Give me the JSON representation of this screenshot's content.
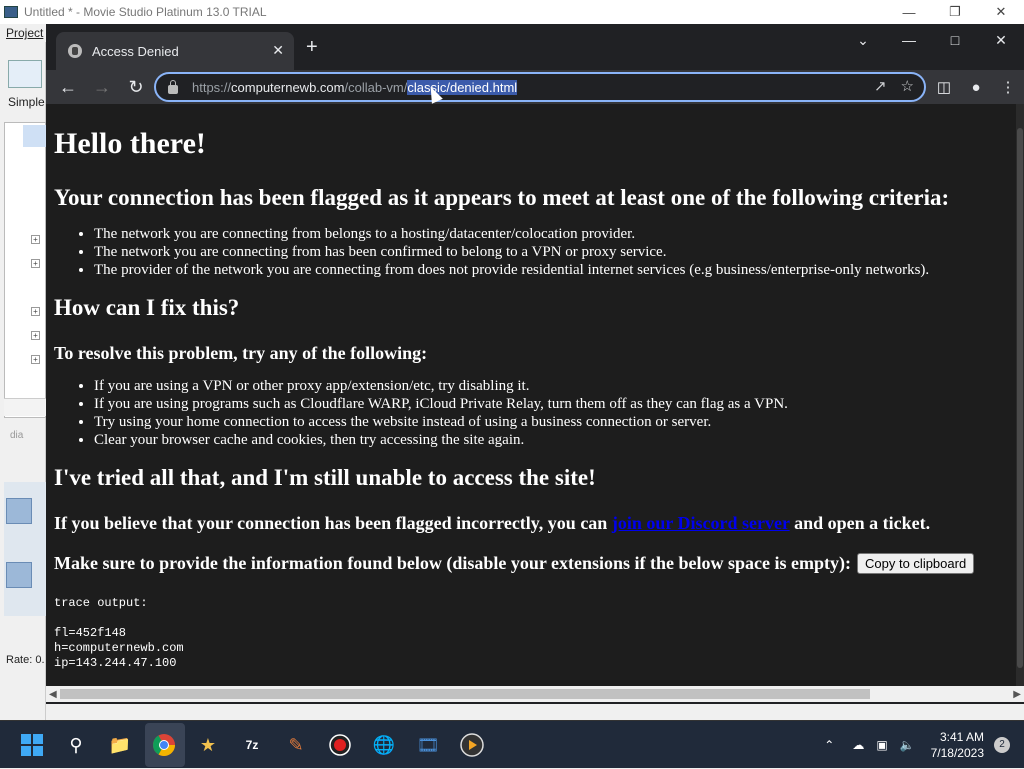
{
  "app": {
    "title": "Untitled * - Movie Studio Platinum 13.0 TRIAL",
    "menu_project": "Project",
    "simple_label": "Simple",
    "dia_label": "dia",
    "rate_label": "Rate: 0."
  },
  "browser": {
    "tab_title": "Access Denied",
    "url_prefix": "https://",
    "url_domain": "computernewb.com",
    "url_path_dim": "/collab-vm/",
    "url_path_selected": "classic/denied.html"
  },
  "page": {
    "hello": "Hello there!",
    "flagged_heading": "Your connection has been flagged as it appears to meet at least one of the following criteria:",
    "criteria": [
      "The network you are connecting from belongs to a hosting/datacenter/colocation provider.",
      "The network you are connecting from has been confirmed to belong to a VPN or proxy service.",
      "The provider of the network you are connecting from does not provide residential internet services (e.g business/enterprise-only networks)."
    ],
    "fix_heading": "How can I fix this?",
    "resolve_heading": "To resolve this problem, try any of the following:",
    "fixes": [
      "If you are using a VPN or other proxy app/extension/etc, try disabling it.",
      "If you are using programs such as Cloudflare WARP, iCloud Private Relay, turn them off as they can flag as a VPN.",
      "Try using your home connection to access the website instead of using a business connection or server.",
      "Clear your browser cache and cookies, then try accessing the site again."
    ],
    "tried_heading": "I've tried all that, and I'm still unable to access the site!",
    "contact_before": "If you believe that your connection has been flagged incorrectly, you can ",
    "contact_link": "join our Discord server",
    "contact_after": " and open a ticket.",
    "provide_text": "Make sure to provide the information found below (disable your extensions if the below space is empty):",
    "copy_button": "Copy to clipboard",
    "trace_lines": [
      "trace output:",
      "",
      "fl=452f148",
      "h=computernewb.com",
      "ip=143.244.47.100"
    ]
  },
  "taskbar": {
    "time": "3:41 AM",
    "date": "7/18/2023",
    "notifications": "2"
  }
}
